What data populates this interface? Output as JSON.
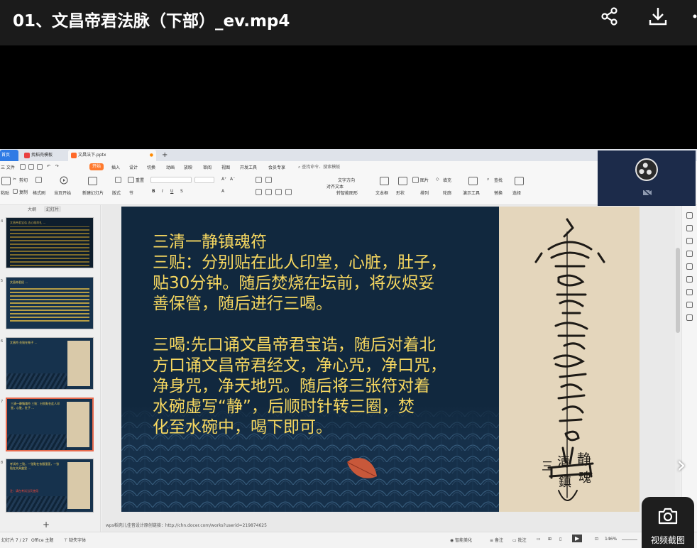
{
  "player": {
    "title": "01、文昌帝君法脉（下部）_ev.mp4",
    "icons": [
      "share-icon",
      "download-icon",
      "more-icon"
    ]
  },
  "wps": {
    "tabs": [
      {
        "label": "首页"
      },
      {
        "label": "找稻壳模板"
      },
      {
        "label": "文昌法下.pptx"
      }
    ],
    "new_tab": "+",
    "menu": [
      "三 文件",
      "开始",
      "插入",
      "设计",
      "切换",
      "动画",
      "放映",
      "审阅",
      "视图",
      "开发工具",
      "会员专享"
    ],
    "menu_active": "开始",
    "search_placeholder": "查找命令、搜索模板",
    "ribbon": {
      "cut": "剪切",
      "paste": "粘贴",
      "copy": "复制",
      "format_painter": "格式刷",
      "from_current": "当页开始",
      "new_slide": "新建幻灯片",
      "layout": "版式",
      "section": "节",
      "reset": "重置",
      "text_dir": "文字方向",
      "align_text": "对齐文本",
      "smartart": "转智能图形",
      "textbox": "文本框",
      "shape": "形状",
      "picture": "图片",
      "fill": "填充",
      "arrange": "排列",
      "outline": "轮廓",
      "present_tools": "演示工具",
      "find": "查找",
      "replace": "替换",
      "select": "选择"
    },
    "left_tabs": [
      "大纲",
      "幻灯片"
    ],
    "add_slide": "+",
    "thumbs": [
      {
        "num": "4",
        "text": "文昌帝君宝诰 志心皈命礼 …"
      },
      {
        "num": "5",
        "text": "文昌帝君经 …",
        "red": ""
      },
      {
        "num": "6",
        "text": "文昌符 先贴在帐子 …"
      },
      {
        "num": "7",
        "text": "三清一静镇魂符 三贴：分别贴在此人印堂，心脏，肚子 …"
      },
      {
        "num": "8",
        "text": "考试符 三贴，一张贴在衣服里面，一张贴在文具盒里 …",
        "red": "注：请在考试当天使用"
      }
    ],
    "slide": {
      "lines": [
        "三清一静镇魂符",
        "三贴：分别贴在此人印堂，心脏，肚子，",
        "贴30分钟。随后焚烧在坛前，将灰烬妥",
        "善保管，随后进行三喝。",
        "",
        "三喝:先口诵文昌帝君宝诰，随后对着北",
        "方口诵文昌帝君经文，净心咒，净口咒，",
        "净身咒，净天地咒。随后将三张符对着",
        "水碗虚写“静”，后顺时针转三圈，焚",
        "化至水碗中，喝下即可。"
      ],
      "talisman_chars": [
        "三",
        "清",
        "静",
        "鎮",
        "魂"
      ]
    },
    "credit": "wps稻壳儿佳音设计原创链接：http://chn.docer.com/works?userid=219874625",
    "status": {
      "slide_of": "幻灯片 7 / 27",
      "theme": "Office 主题",
      "missing_font": "缺失字体",
      "smart_beautify": "智能美化",
      "notes": "备注",
      "comments": "批注",
      "zoom": "146%"
    }
  },
  "overlay": {
    "screenshot_label": "视频截图",
    "next_chevron": "›"
  },
  "colors": {
    "slide_bg": "#11283e",
    "slide_text": "#f7d860",
    "accent": "#ff7a2e"
  }
}
